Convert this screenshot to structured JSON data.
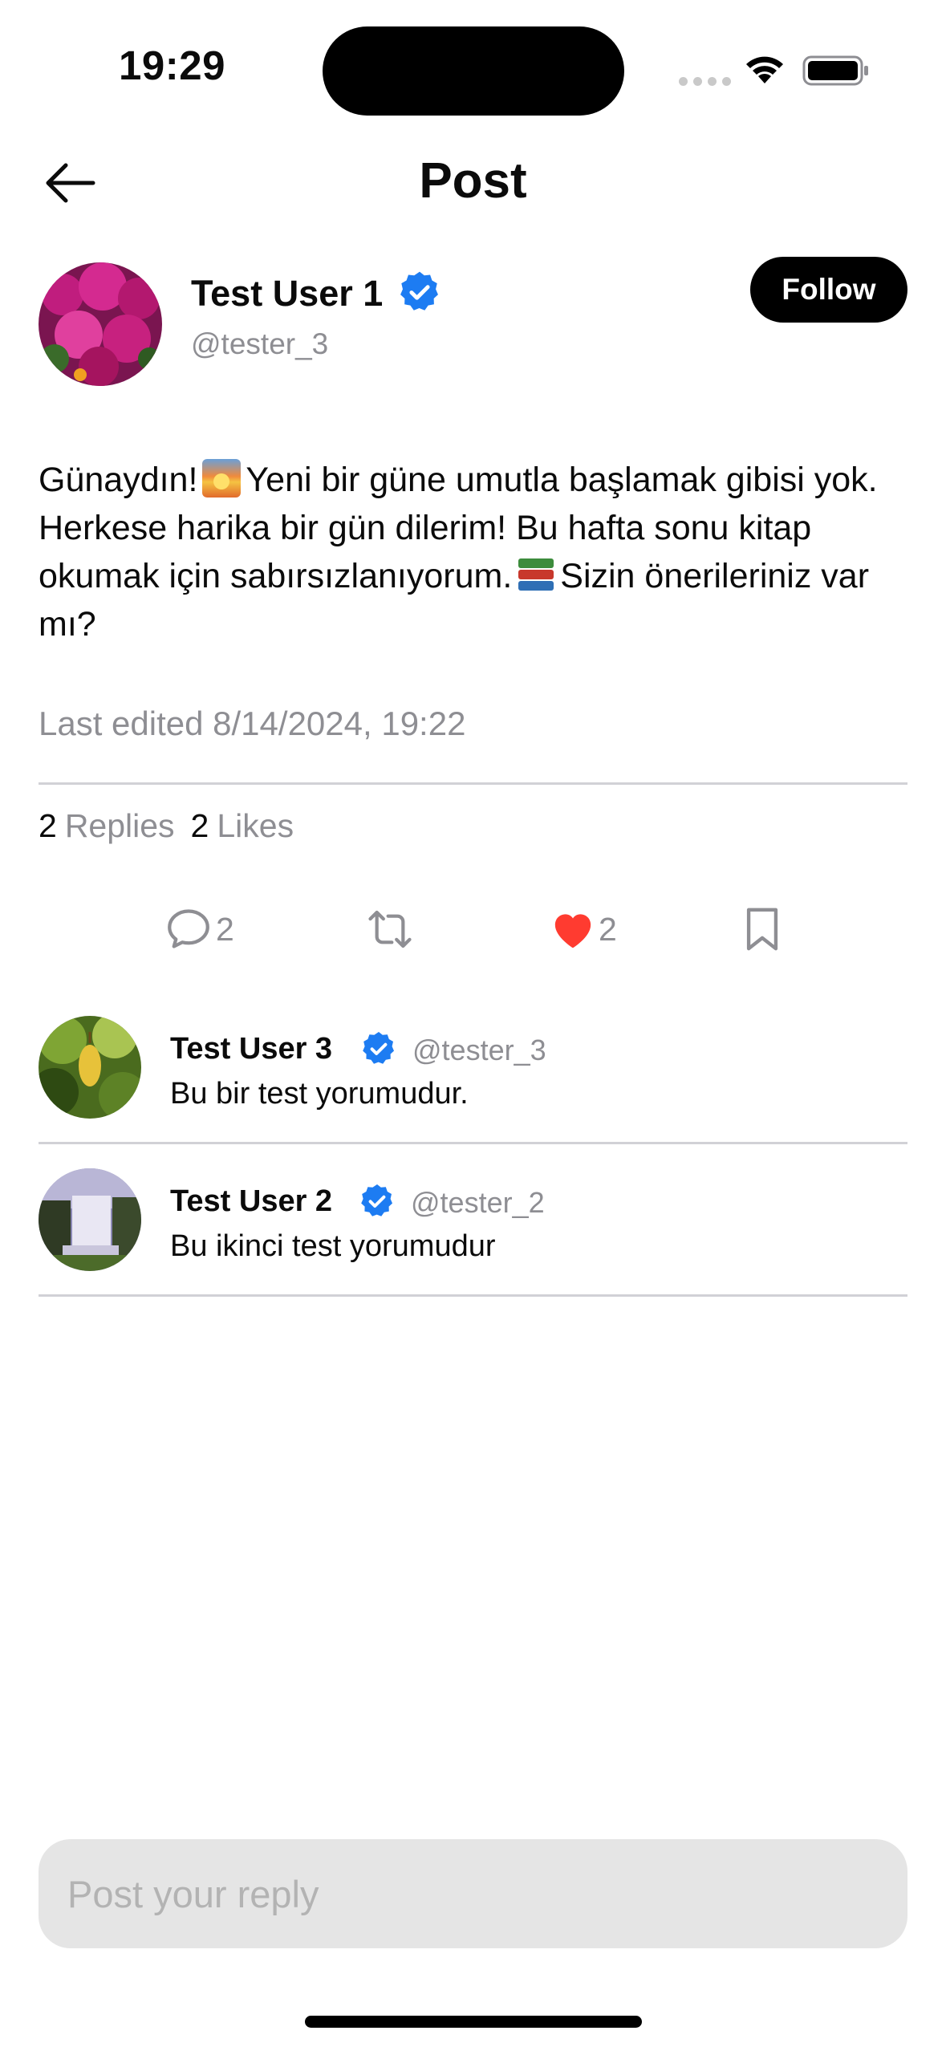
{
  "status_bar": {
    "time": "19:29"
  },
  "header": {
    "title": "Post",
    "back_icon": "arrow-left-icon"
  },
  "post": {
    "author": {
      "name": "Test User 1",
      "handle": "@tester_3",
      "verified": true,
      "follow_label": "Follow"
    },
    "text_parts": {
      "p1": "Günaydın!",
      "p2": "Yeni bir güne umutla başlamak gibisi yok. Herkese harika bir gün dilerim! Bu hafta sonu kitap okumak için sabırsızlanıyorum.",
      "p3": "Sizin önerileriniz var mı?"
    },
    "emojis": [
      "sunrise-emoji",
      "books-emoji"
    ],
    "edited": "Last edited 8/14/2024, 19:22",
    "stats": {
      "replies_count": "2",
      "replies_label": "Replies",
      "likes_count": "2",
      "likes_label": "Likes"
    },
    "actions": {
      "reply_count": "2",
      "like_count": "2",
      "liked": true,
      "like_color": "#ff3b30"
    }
  },
  "replies": [
    {
      "name": "Test User 3",
      "handle": "@tester_3",
      "verified": true,
      "text": "Bu bir test yorumudur."
    },
    {
      "name": "Test User 2",
      "handle": "@tester_2",
      "verified": true,
      "text": "Bu ikinci test yorumudur"
    }
  ],
  "reply_input": {
    "placeholder": "Post your reply",
    "value": ""
  },
  "colors": {
    "verified": "#1d7cf2",
    "accent": "#000000",
    "muted": "#8e8e93"
  }
}
